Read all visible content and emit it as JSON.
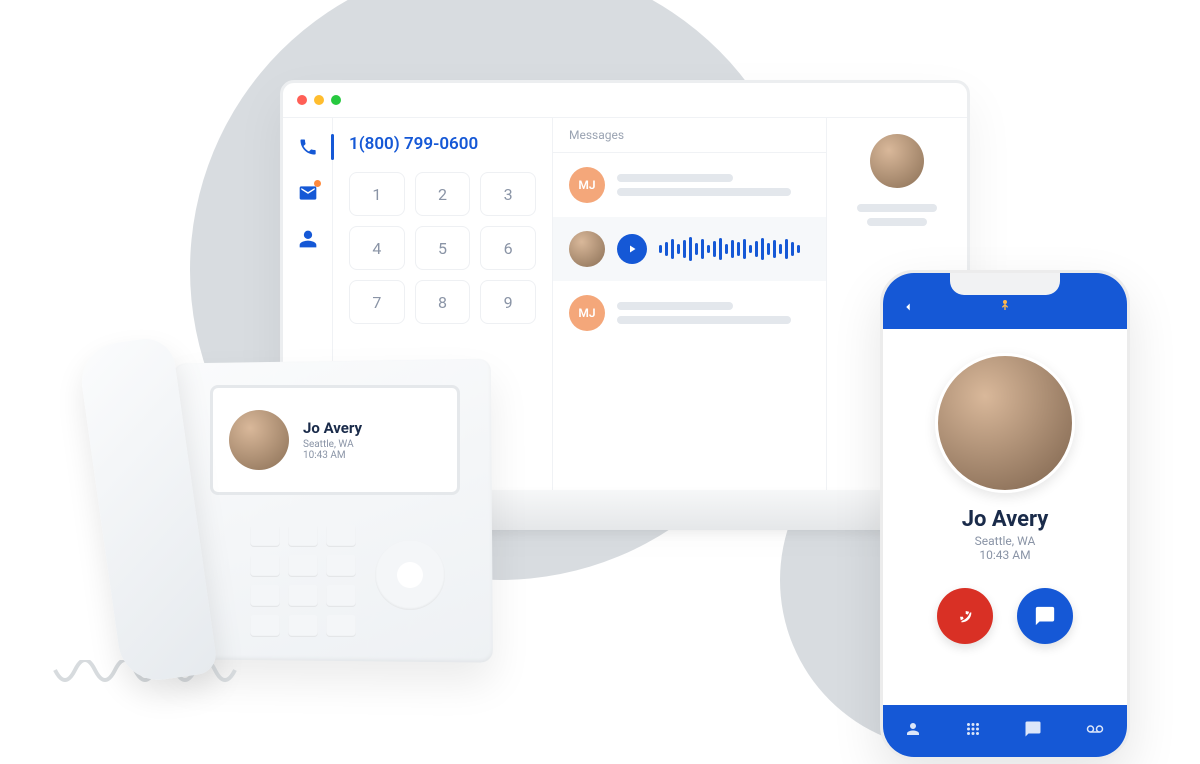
{
  "deskphone": {
    "caller": {
      "name": "Jo Avery",
      "location": "Seattle, WA",
      "time": "10:43 AM"
    }
  },
  "laptop": {
    "dialer": {
      "number": "1(800) 799-0600",
      "keys": [
        "1",
        "2",
        "3",
        "4",
        "5",
        "6",
        "7",
        "8",
        "9"
      ]
    },
    "messages": {
      "header": "Messages",
      "items": [
        {
          "initials": "MJ"
        },
        {
          "initials": "MJ"
        }
      ]
    }
  },
  "mobile": {
    "caller": {
      "name": "Jo Avery",
      "location": "Seattle, WA",
      "time": "10:43 AM"
    }
  }
}
